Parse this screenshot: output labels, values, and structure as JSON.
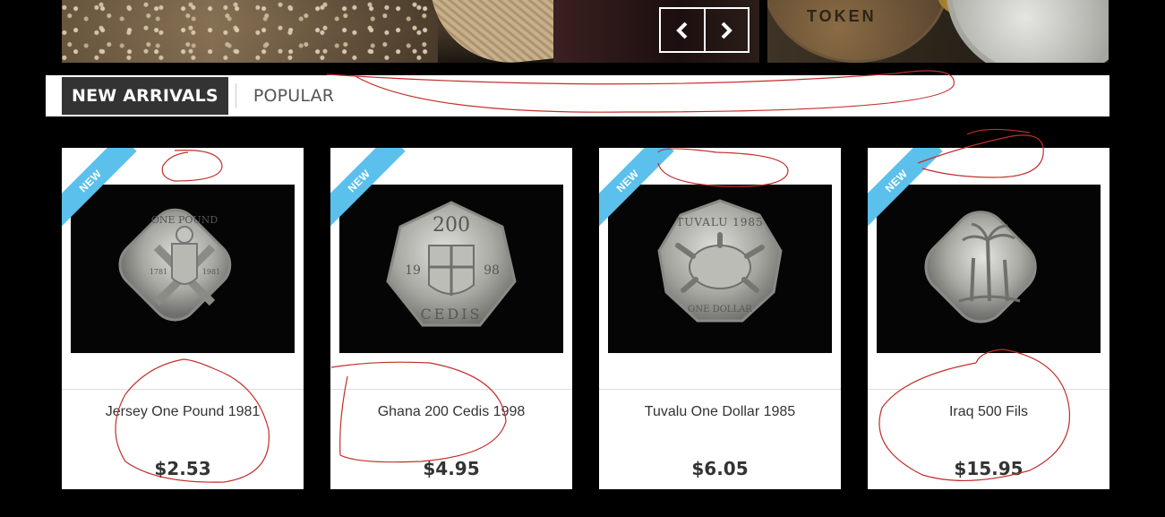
{
  "tabs": [
    {
      "label": "New Arrivals",
      "active": true
    },
    {
      "label": "Popular",
      "active": false
    }
  ],
  "colors": {
    "ribbon": "#5bc0eb",
    "active_tab": "#333333",
    "annotation": "#c0302c"
  },
  "slider": {
    "prev_icon": "chevron-left-icon",
    "next_icon": "chevron-right-icon"
  },
  "hero": {
    "coin_text": "TOKEN"
  },
  "products": [
    {
      "badge": "NEW",
      "name": "Jersey One Pound 1981",
      "price": "$2.53",
      "coin": {
        "shape": "square",
        "top_text": "ONE POUND",
        "left_date": "1781",
        "right_date": "1981"
      }
    },
    {
      "badge": "NEW",
      "name": "Ghana 200 Cedis 1998",
      "price": "$4.95",
      "coin": {
        "shape": "heptagon",
        "top_text": "200",
        "left_date": "19",
        "right_date": "98",
        "bottom_text": "CEDIS"
      }
    },
    {
      "badge": "NEW",
      "name": "Tuvalu One Dollar 1985",
      "price": "$6.05",
      "coin": {
        "shape": "nonagon",
        "top_text": "TUVALU 1985",
        "bottom_text": "ONE DOLLAR"
      }
    },
    {
      "badge": "NEW",
      "name": "Iraq 500 Fils",
      "price": "$15.95",
      "coin": {
        "shape": "square"
      }
    }
  ]
}
